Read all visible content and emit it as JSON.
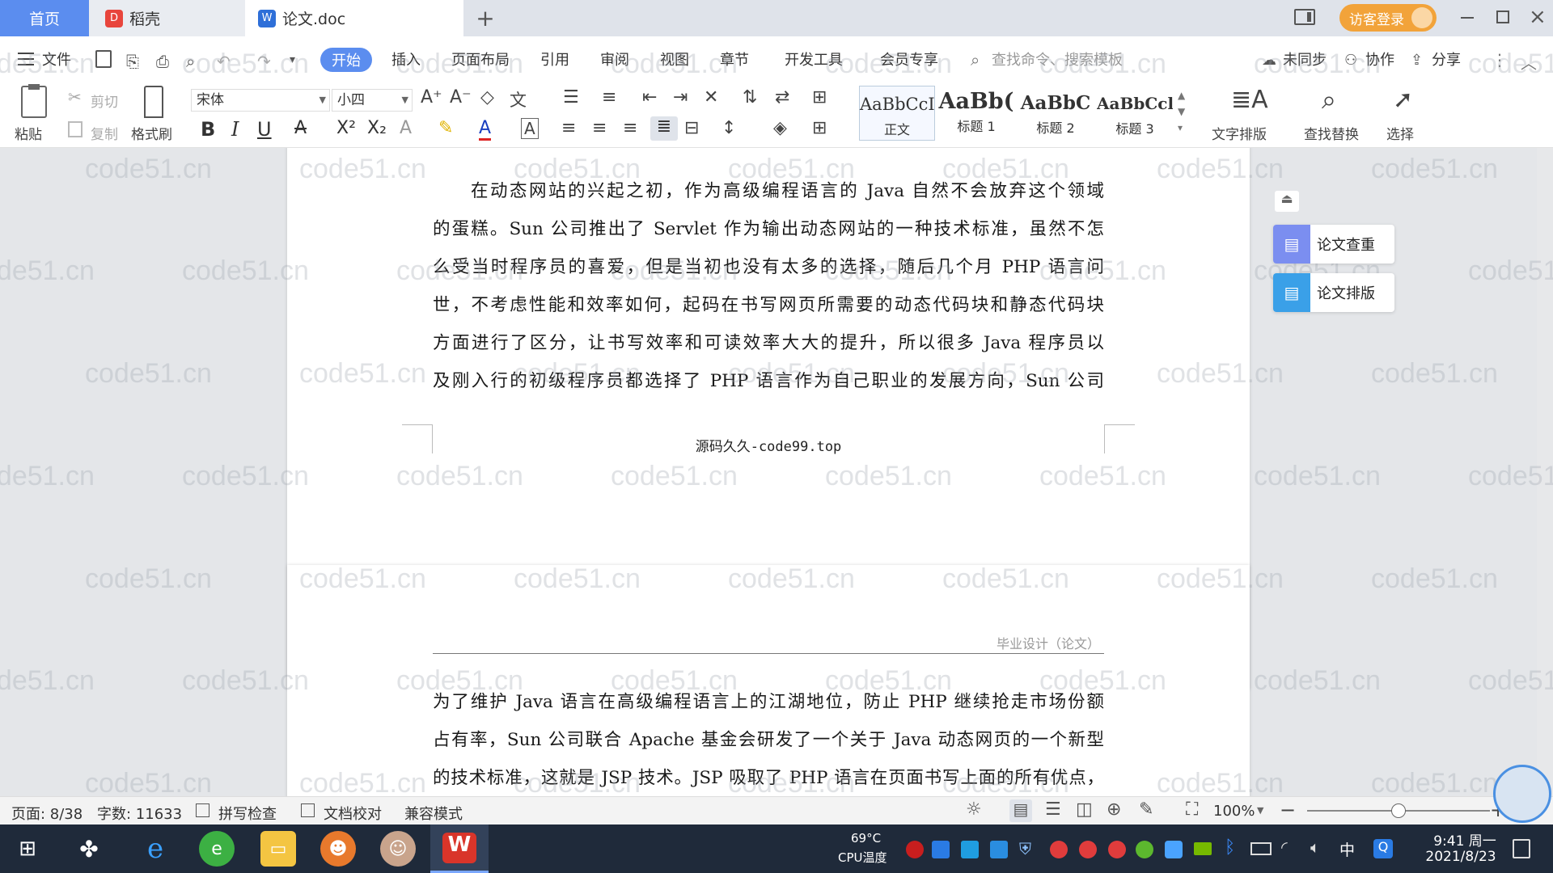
{
  "tabs": {
    "home": "首页",
    "daoke": "稻壳",
    "doc": "论文.doc",
    "add": "+"
  },
  "titlebar": {
    "login": "访客登录"
  },
  "menu": {
    "file": "文件",
    "items": [
      "开始",
      "插入",
      "页面布局",
      "引用",
      "审阅",
      "视图",
      "章节",
      "开发工具",
      "会员专享"
    ],
    "search_placeholder": "查找命令、搜索模板",
    "sync": "未同步",
    "collab": "协作",
    "share": "分享"
  },
  "ribbon": {
    "paste": "粘贴",
    "cut": "剪切",
    "copy": "复制",
    "format_painter": "格式刷",
    "font_name": "宋体",
    "font_size": "小四",
    "styles": [
      {
        "preview": "AaBbCcI",
        "name": "正文"
      },
      {
        "preview": "AaBb(",
        "name": "标题 1"
      },
      {
        "preview": "AaBbC",
        "name": "标题 2"
      },
      {
        "preview": "AaBbCcl",
        "name": "标题 3"
      }
    ],
    "text_layout": "文字排版",
    "find_replace": "查找替换",
    "select": "选择"
  },
  "document": {
    "page1_lines": [
      "在动态网站的兴起之初，作为高级编程语言的 Java 自然不会放弃这个领域",
      "的蛋糕。Sun 公司推出了 Servlet 作为输出动态网站的一种技术标准，虽然不怎",
      "么受当时程序员的喜爱，但是当初也没有太多的选择，随后几个月 PHP 语言问",
      "世，不考虑性能和效率如何，起码在书写网页所需要的动态代码块和静态代码块",
      "方面进行了区分，让书写效率和可读效率大大的提升，所以很多 Java 程序员以",
      "及刚入行的初级程序员都选择了 PHP 语言作为自己职业的发展方向，Sun 公司"
    ],
    "footer_text": "源码久久-code99.top",
    "page2_header": "毕业设计（论文）",
    "page2_lines": [
      "为了维护 Java 语言在高级编程语言上的江湖地位，防止 PHP 继续抢走市场份额",
      "占有率，Sun 公司联合 Apache 基金会研发了一个关于 Java 动态网页的一个新型",
      "的技术标准，这就是 JSP 技术。JSP 吸取了 PHP 语言在页面书写上面的所有优点，"
    ],
    "watermark": "code51.cn"
  },
  "sidepanel": {
    "check": "论文查重",
    "layout": "论文排版"
  },
  "status": {
    "page": "页面: 8/38",
    "words": "字数: 11633",
    "spell": "拼写检查",
    "proof": "文档校对",
    "compat": "兼容模式",
    "zoom": "100%"
  },
  "taskbar": {
    "cpu_temp": "69°C",
    "cpu_label": "CPU温度",
    "ime": "中",
    "time": "9:41 周一",
    "date": "2021/8/23"
  },
  "colors": {
    "accent": "#5b8def",
    "login_bg": "#f2a33a",
    "wps_red": "#d9352a"
  }
}
